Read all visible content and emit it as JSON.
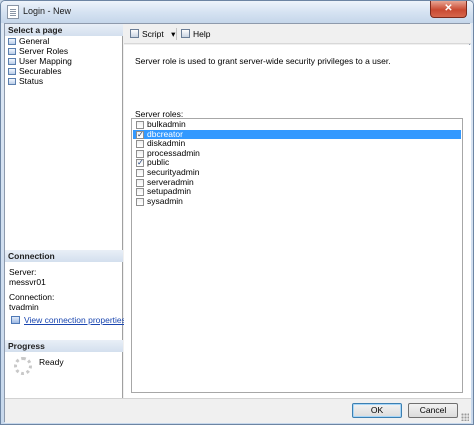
{
  "window": {
    "title": "Login - New",
    "close_glyph": "✕"
  },
  "left_pane": {
    "select_page_header": "Select a page",
    "pages": [
      {
        "label": "General",
        "icon": "page-icon"
      },
      {
        "label": "Server Roles",
        "icon": "page-icon"
      },
      {
        "label": "User Mapping",
        "icon": "page-icon"
      },
      {
        "label": "Securables",
        "icon": "page-icon"
      },
      {
        "label": "Status",
        "icon": "page-icon"
      }
    ],
    "connection": {
      "header": "Connection",
      "server_label": "Server:",
      "server_value": "messvr01",
      "connection_label": "Connection:",
      "connection_value": "tvadmin",
      "view_properties_link": "View connection properties"
    },
    "progress": {
      "header": "Progress",
      "status": "Ready"
    }
  },
  "toolbar": {
    "script_label": "Script",
    "script_dropdown_glyph": "▾",
    "help_label": "Help"
  },
  "main": {
    "description": "Server role is used to grant server-wide security privileges to a user.",
    "roles_label": "Server roles:",
    "roles": [
      {
        "name": "bulkadmin",
        "checked": false,
        "selected": false
      },
      {
        "name": "dbcreator",
        "checked": true,
        "selected": true
      },
      {
        "name": "diskadmin",
        "checked": false,
        "selected": false
      },
      {
        "name": "processadmin",
        "checked": false,
        "selected": false
      },
      {
        "name": "public",
        "checked": true,
        "selected": false
      },
      {
        "name": "securityadmin",
        "checked": false,
        "selected": false
      },
      {
        "name": "serveradmin",
        "checked": false,
        "selected": false
      },
      {
        "name": "setupadmin",
        "checked": false,
        "selected": false
      },
      {
        "name": "sysadmin",
        "checked": false,
        "selected": false
      }
    ]
  },
  "buttons": {
    "ok": "OK",
    "cancel": "Cancel"
  },
  "colors": {
    "selection": "#3399ff",
    "link": "#1a46b0",
    "close_button": "#c94a32"
  }
}
